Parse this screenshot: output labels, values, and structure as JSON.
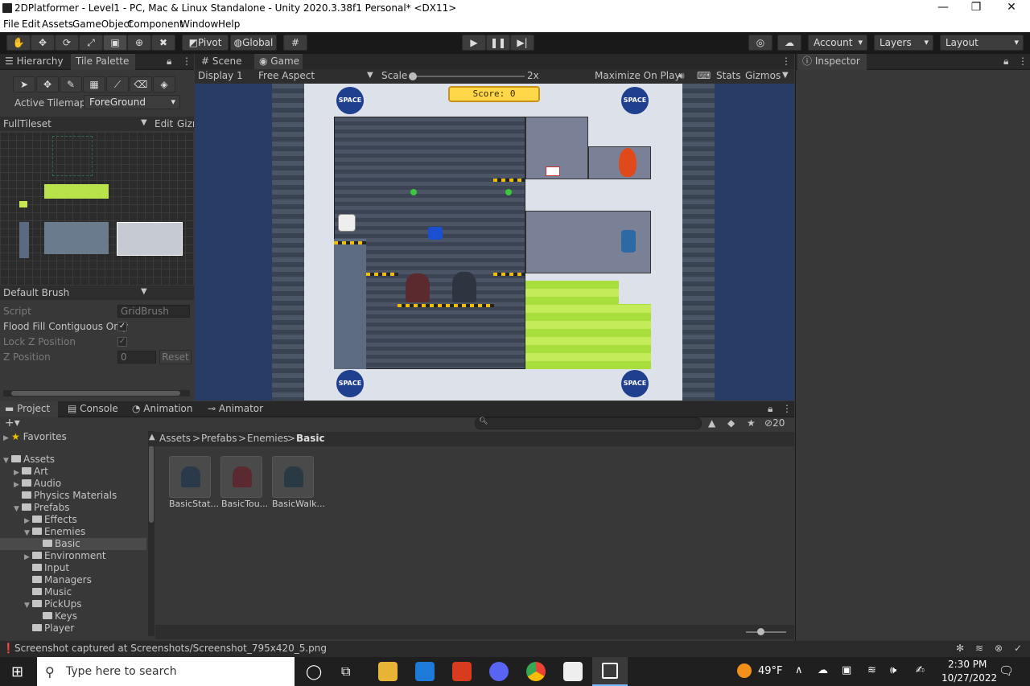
{
  "window": {
    "title": "2DPlatformer - Level1 - PC, Mac & Linux Standalone - Unity 2020.3.38f1 Personal* <DX11>",
    "minimize": "—",
    "maximize": "❐",
    "close": "✕"
  },
  "menu": [
    "File",
    "Edit",
    "Assets",
    "GameObject",
    "Component",
    "Window",
    "Help"
  ],
  "toolbar": {
    "pivot": "Pivot",
    "global": "Global",
    "account": "Account",
    "layers": "Layers",
    "layout": "Layout"
  },
  "left_tabs": {
    "hierarchy": "Hierarchy",
    "tile_palette": "Tile Palette"
  },
  "tile_palette": {
    "active_tilemap_label": "Active Tilemap",
    "active_tilemap_value": "ForeGround",
    "palette": "FullTileset",
    "edit": "Edit",
    "gizmos": "Gizr",
    "brush": "Default Brush",
    "script_label": "Script",
    "script_value": "GridBrush",
    "flood_fill_label": "Flood Fill Contiguous Only",
    "lock_z_label": "Lock Z Position",
    "z_position_label": "Z Position",
    "z_position_value": "0",
    "reset": "Reset"
  },
  "center_tabs": {
    "scene": "Scene",
    "game": "Game"
  },
  "game_bar": {
    "display": "Display 1",
    "aspect": "Free Aspect",
    "scale_label": "Scale",
    "scale_value": "2x",
    "maximize": "Maximize On Play",
    "stats": "Stats",
    "gizmos": "Gizmos"
  },
  "game": {
    "score": "Score: 0",
    "badge": "SPACE"
  },
  "inspector": {
    "title": "Inspector"
  },
  "bottom_tabs": {
    "project": "Project",
    "console": "Console",
    "animation": "Animation",
    "animator": "Animator"
  },
  "project": {
    "hidden_count": "20",
    "breadcrumb": [
      "Assets",
      "Prefabs",
      "Enemies",
      "Basic"
    ],
    "favorites": "Favorites",
    "tree": [
      {
        "label": "Assets",
        "depth": 0,
        "open": true
      },
      {
        "label": "Art",
        "depth": 1,
        "open": false
      },
      {
        "label": "Audio",
        "depth": 1,
        "open": false
      },
      {
        "label": "Physics Materials",
        "depth": 1,
        "open": null
      },
      {
        "label": "Prefabs",
        "depth": 1,
        "open": true
      },
      {
        "label": "Effects",
        "depth": 2,
        "open": false
      },
      {
        "label": "Enemies",
        "depth": 2,
        "open": true
      },
      {
        "label": "Basic",
        "depth": 3,
        "open": null,
        "selected": true
      },
      {
        "label": "Environment",
        "depth": 2,
        "open": false
      },
      {
        "label": "Input",
        "depth": 2,
        "open": null
      },
      {
        "label": "Managers",
        "depth": 2,
        "open": null
      },
      {
        "label": "Music",
        "depth": 2,
        "open": null
      },
      {
        "label": "PickUps",
        "depth": 2,
        "open": true
      },
      {
        "label": "Keys",
        "depth": 3,
        "open": null
      },
      {
        "label": "Player",
        "depth": 2,
        "open": null
      }
    ],
    "assets": [
      "BasicStat...",
      "BasicTou...",
      "BasicWalk..."
    ]
  },
  "status": {
    "message": "Screenshot captured at Screenshots/Screenshot_795x420_5.png"
  },
  "taskbar": {
    "search_placeholder": "Type here to search",
    "weather": "49°F",
    "time": "2:30 PM",
    "date": "10/27/2022"
  }
}
